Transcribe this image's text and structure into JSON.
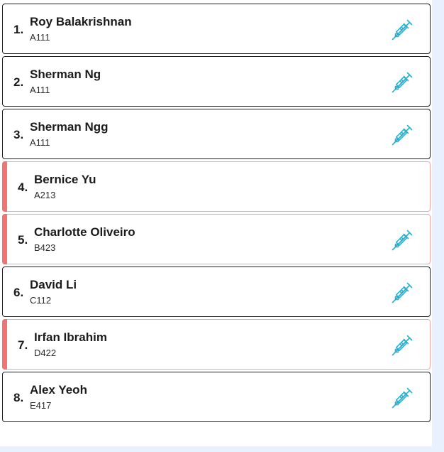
{
  "patients": [
    {
      "number": "1.",
      "name": "Roy Balakrishnan",
      "code": "A111",
      "flagged": false,
      "has_vaccine_icon": true
    },
    {
      "number": "2.",
      "name": "Sherman Ng",
      "code": "A111",
      "flagged": false,
      "has_vaccine_icon": true
    },
    {
      "number": "3.",
      "name": "Sherman Ngg",
      "code": "A111",
      "flagged": false,
      "has_vaccine_icon": true
    },
    {
      "number": "4.",
      "name": "Bernice Yu",
      "code": "A213",
      "flagged": true,
      "has_vaccine_icon": false
    },
    {
      "number": "5.",
      "name": "Charlotte Oliveiro",
      "code": "B423",
      "flagged": true,
      "has_vaccine_icon": true
    },
    {
      "number": "6.",
      "name": "David Li",
      "code": "C112",
      "flagged": false,
      "has_vaccine_icon": true
    },
    {
      "number": "7.",
      "name": "Irfan Ibrahim",
      "code": "D422",
      "flagged": true,
      "has_vaccine_icon": true
    },
    {
      "number": "8.",
      "name": "Alex Yeoh",
      "code": "E417",
      "flagged": false,
      "has_vaccine_icon": true
    }
  ],
  "icon": "syringe-icon",
  "colors": {
    "flag": "#f07474",
    "flag_border": "#f4a6a6",
    "icon": "#1fb3d6",
    "background": "#e8f1fd"
  }
}
